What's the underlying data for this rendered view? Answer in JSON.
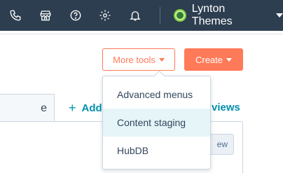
{
  "topbar": {
    "icons": [
      "phone-icon",
      "marketplace-icon",
      "help-icon",
      "settings-icon",
      "notifications-icon"
    ],
    "account_name": "Lynton Themes"
  },
  "toolbar": {
    "more_tools_label": "More tools",
    "create_label": "Create"
  },
  "menu": {
    "items": [
      {
        "label": "Advanced menus"
      },
      {
        "label": "Content staging"
      },
      {
        "label": "HubDB"
      }
    ]
  },
  "tabs": {
    "partial_tab_label": "e",
    "add_view_label": "Add",
    "all_views_label": "views"
  },
  "table": {
    "button_label": "ew"
  },
  "colors": {
    "nav_bg": "#2d3e50",
    "accent": "#ff7a59",
    "link": "#0091ae",
    "menu_highlight": "#e5f5f8"
  }
}
